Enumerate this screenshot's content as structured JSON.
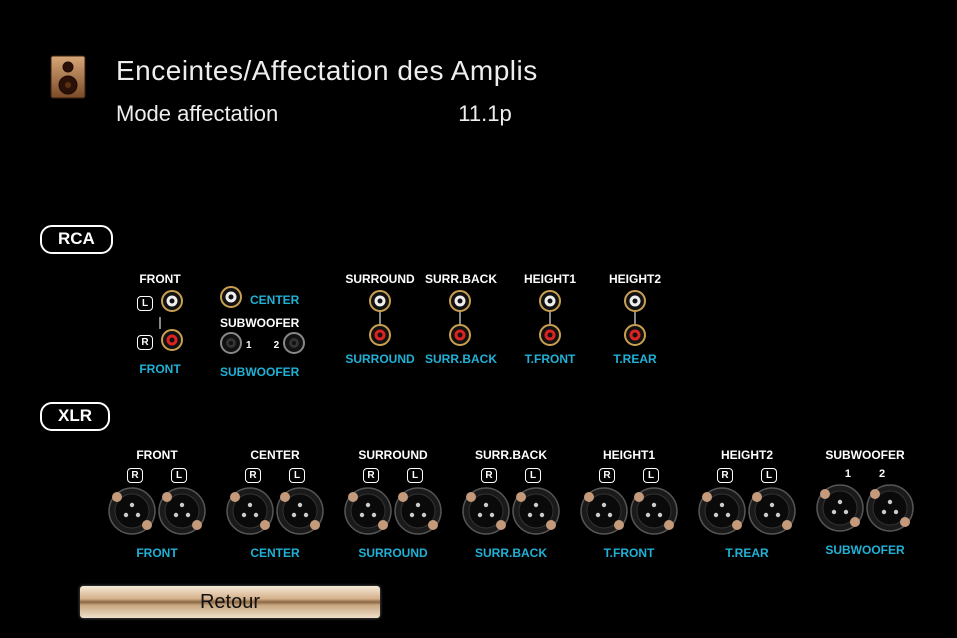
{
  "header": {
    "title": "Enceintes/Affectation des Amplis",
    "mode_label": "Mode affectation",
    "mode_value": "11.1p"
  },
  "sections": {
    "rca_badge": "RCA",
    "xlr_badge": "XLR"
  },
  "rca": {
    "front": {
      "top": "FRONT",
      "bottom": "FRONT",
      "l": "L",
      "r": "R"
    },
    "center": {
      "label": "CENTER",
      "sub_label": "SUBWOOFER",
      "one": "1",
      "two": "2",
      "bottom": "SUBWOOFER"
    },
    "groups": [
      {
        "top": "SURROUND",
        "bottom": "SURROUND"
      },
      {
        "top": "SURR.BACK",
        "bottom": "SURR.BACK"
      },
      {
        "top": "HEIGHT1",
        "bottom": "T.FRONT"
      },
      {
        "top": "HEIGHT2",
        "bottom": "T.REAR"
      }
    ]
  },
  "xlr": {
    "r": "R",
    "l": "L",
    "one": "1",
    "two": "2",
    "groups": [
      {
        "top": "FRONT",
        "bottom": "FRONT"
      },
      {
        "top": "CENTER",
        "bottom": "CENTER"
      },
      {
        "top": "SURROUND",
        "bottom": "SURROUND"
      },
      {
        "top": "SURR.BACK",
        "bottom": "SURR.BACK"
      },
      {
        "top": "HEIGHT1",
        "bottom": "T.FRONT"
      },
      {
        "top": "HEIGHT2",
        "bottom": "T.REAR"
      },
      {
        "top": "SUBWOOFER",
        "bottom": "SUBWOOFER"
      }
    ]
  },
  "buttons": {
    "retour": "Retour"
  }
}
